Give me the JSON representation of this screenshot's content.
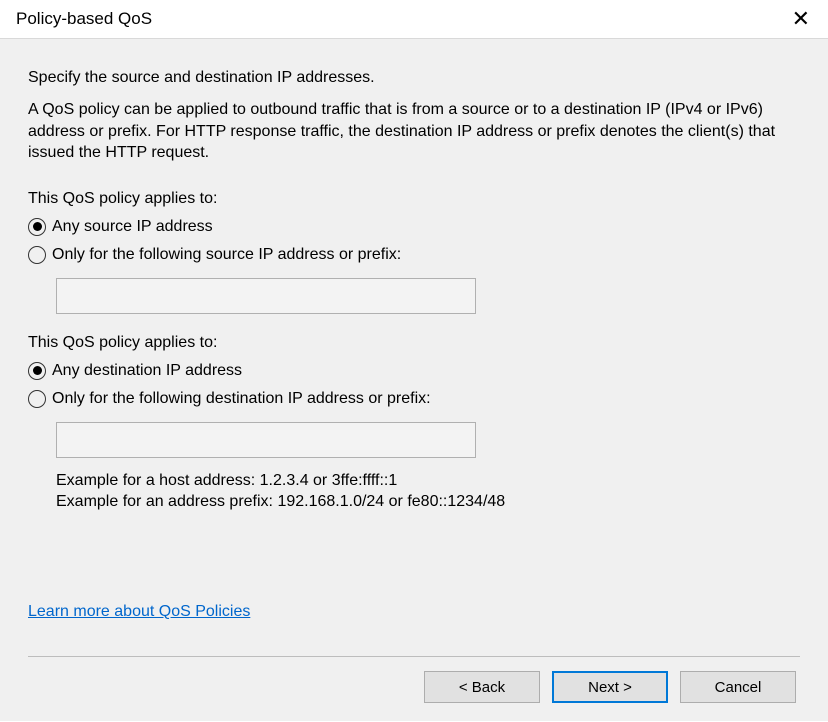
{
  "title": "Policy-based QoS",
  "heading": "Specify the source and destination IP addresses.",
  "description": "A QoS policy can be applied to outbound traffic that is from a source or to a destination IP (IPv4 or IPv6) address or prefix. For HTTP response traffic, the destination IP address or prefix denotes the client(s) that issued the HTTP request.",
  "source": {
    "group_label": "This QoS policy applies to:",
    "option_any": "Any source IP address",
    "option_specific": "Only for the following source IP address or prefix:",
    "input_value": ""
  },
  "dest": {
    "group_label": "This QoS policy applies to:",
    "option_any": "Any destination IP address",
    "option_specific": "Only for the following destination IP address or prefix:",
    "input_value": ""
  },
  "example_host": "Example for a host address: 1.2.3.4 or 3ffe:ffff::1",
  "example_prefix": "Example for an address prefix: 192.168.1.0/24 or fe80::1234/48",
  "link_label": "Learn more about QoS Policies",
  "buttons": {
    "back": "< Back",
    "next": "Next >",
    "cancel": "Cancel"
  }
}
